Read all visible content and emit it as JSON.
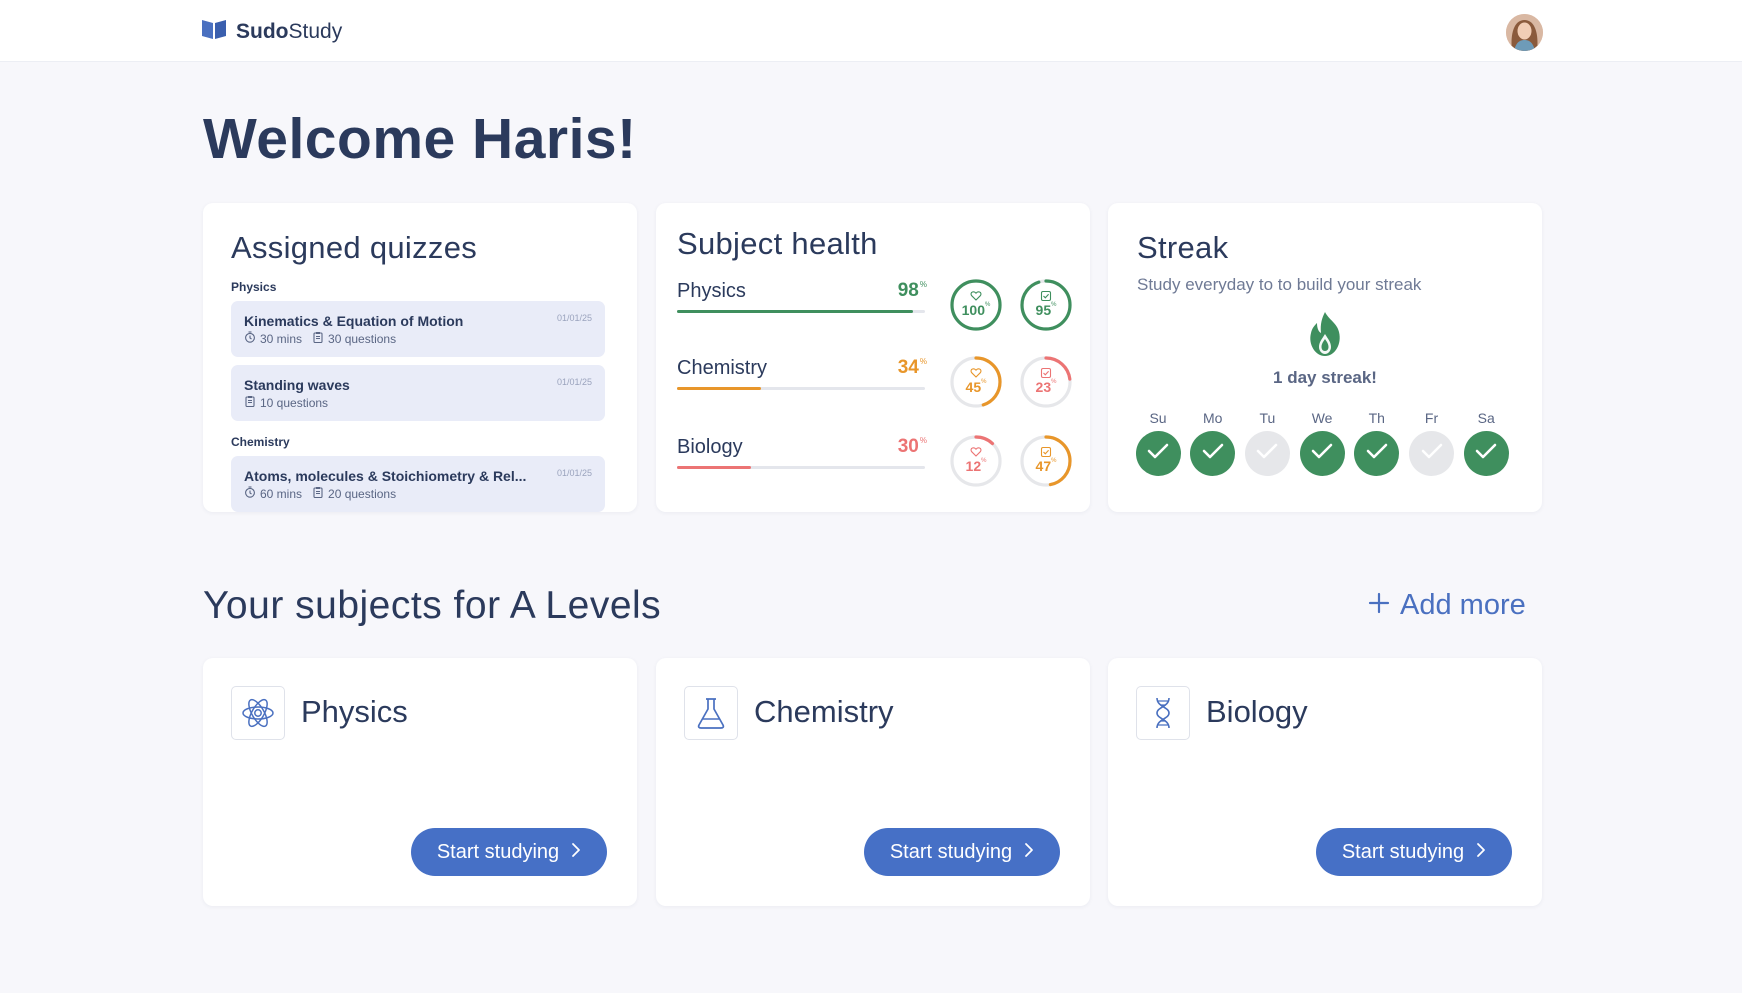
{
  "header": {
    "brand_bold": "Sudo",
    "brand_rest": "Study"
  },
  "welcome": "Welcome Haris!",
  "assigned": {
    "title": "Assigned quizzes",
    "groups": [
      {
        "label": "Physics",
        "items": [
          {
            "title": "Kinematics & Equation of Motion",
            "date": "01/01/25",
            "duration": "30 mins",
            "questions": "30 questions"
          },
          {
            "title": "Standing waves",
            "date": "01/01/25",
            "questions": "10 questions"
          }
        ]
      },
      {
        "label": "Chemistry",
        "items": [
          {
            "title": "Atoms, molecules & Stoichiometry & Rel...",
            "date": "01/01/25",
            "duration": "60 mins",
            "questions": "20 questions"
          }
        ]
      }
    ]
  },
  "health": {
    "title": "Subject health",
    "rows": [
      {
        "name": "Physics",
        "value": "98",
        "pct": 0.95,
        "color": "#3f8f5e",
        "ring1": {
          "value": "100",
          "pct": 1.0,
          "color": "#3f8f5e",
          "icon": "heart-icon"
        },
        "ring2": {
          "value": "95",
          "pct": 0.95,
          "color": "#3f8f5e",
          "icon": "check-square-icon"
        }
      },
      {
        "name": "Chemistry",
        "value": "34",
        "pct": 0.34,
        "color": "#e8962a",
        "ring1": {
          "value": "45",
          "pct": 0.45,
          "color": "#e8962a",
          "icon": "heart-icon"
        },
        "ring2": {
          "value": "23",
          "pct": 0.23,
          "color": "#ec7474",
          "icon": "check-square-icon"
        }
      },
      {
        "name": "Biology",
        "value": "30",
        "pct": 0.3,
        "color": "#ec7474",
        "ring1": {
          "value": "12",
          "pct": 0.12,
          "color": "#ec7474",
          "icon": "heart-icon"
        },
        "ring2": {
          "value": "47",
          "pct": 0.47,
          "color": "#e8962a",
          "icon": "check-square-icon"
        }
      }
    ],
    "percent_sign": "%"
  },
  "streak": {
    "title": "Streak",
    "subtitle": "Study everyday to to build your streak",
    "label": "1 day streak!",
    "days": [
      {
        "label": "Su",
        "done": true
      },
      {
        "label": "Mo",
        "done": true
      },
      {
        "label": "Tu",
        "done": false
      },
      {
        "label": "We",
        "done": true
      },
      {
        "label": "Th",
        "done": true
      },
      {
        "label": "Fr",
        "done": false
      },
      {
        "label": "Sa",
        "done": true
      }
    ],
    "done_color": "#3f8f5e",
    "missed_color": "#e6e7ea"
  },
  "subjects": {
    "title": "Your subjects for A Levels",
    "add_more": "Add more",
    "items": [
      {
        "name": "Physics",
        "icon": "atom-icon",
        "button": "Start studying"
      },
      {
        "name": "Chemistry",
        "icon": "flask-icon",
        "button": "Start studying"
      },
      {
        "name": "Biology",
        "icon": "dna-icon",
        "button": "Start studying"
      }
    ]
  }
}
